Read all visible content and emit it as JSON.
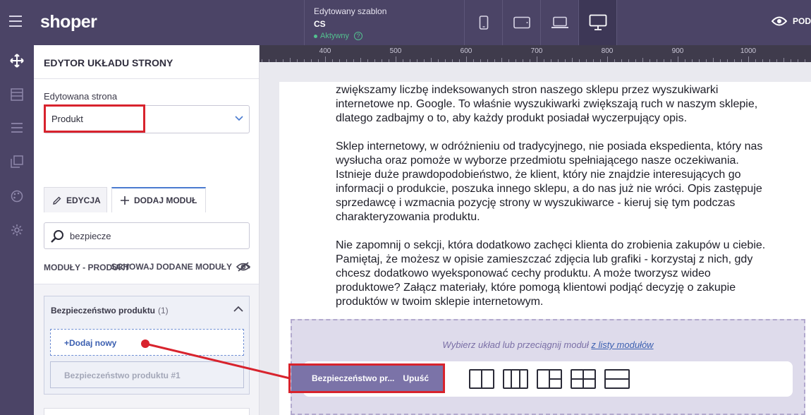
{
  "app": {
    "logo": "shoper"
  },
  "template": {
    "label": "Edytowany szablon",
    "name": "CS",
    "status": "Aktywny"
  },
  "devices": [
    {
      "name": "phone",
      "active": false
    },
    {
      "name": "tablet",
      "active": false
    },
    {
      "name": "laptop",
      "active": false
    },
    {
      "name": "desktop",
      "active": true
    }
  ],
  "preview": {
    "label": "PODGLĄD"
  },
  "panel": {
    "title": "EDYTOR UKŁADU STRONY",
    "edited_label": "Edytowana strona",
    "edited_value": "Produkt",
    "tabs": {
      "edit": "EDYCJA",
      "add": "DODAJ MODUŁ"
    },
    "search_value": "bezpiecze",
    "hide_added": "SCHOWAJ DODANE MODUŁY",
    "modules_head": "MODUŁY - PRODUKT",
    "module": {
      "title": "Bezpieczeństwo produktu",
      "count": "(1)",
      "add_new": "+Dodaj nowy",
      "existing": "Bezpieczeństwo produktu #1"
    }
  },
  "ruler": {
    "labels": [
      "400",
      "500",
      "600",
      "700",
      "800",
      "900",
      "1000"
    ]
  },
  "content": {
    "p1": "zwiększamy liczbę indeksowanych stron naszego sklepu przez wyszukiwarki internetowe np. Google. To właśnie wyszukiwarki zwiększają ruch w naszym sklepie, dlatego zadbajmy o to, aby każdy produkt posiadał wyczerpujący opis.",
    "p2": "Sklep internetowy, w odróżnieniu od tradycyjnego, nie posiada ekspedienta, który nas wysłucha oraz pomoże w wyborze przedmiotu spełniającego nasze oczekiwania. Istnieje duże prawdopodobieństwo, że klient, który nie znajdzie interesujących go informacji o produkcie, poszuka innego sklepu, a do nas już nie wróci. Opis zastępuje sprzedawcę i wzmacnia pozycję strony w wyszukiwarce - kieruj się tym podczas charakteryzowania produktu.",
    "p3": "Nie zapomnij o sekcji, która dodatkowo zachęci klienta do zrobienia zakupów u ciebie. Pamiętaj, że możesz w opisie zamieszczać zdjęcia lub grafiki - korzystaj z nich, gdy chcesz dodatkowo wyeksponować cechy produktu. A może tworzysz wideo produktowe? Załącz materiały, które pomogą klientowi podjąć decyzję o zakupie produktów w twoim sklepie internetowym."
  },
  "dropzone": {
    "hint": "Wybierz układ lub przeciągnij moduł",
    "link": "z listy modułów"
  },
  "drag": {
    "label": "Bezpieczeństwo pr...",
    "action": "Upuść"
  },
  "colors": {
    "topbar": "#4b4466",
    "accent": "#3b5fb0",
    "annotation": "#d8232d"
  }
}
